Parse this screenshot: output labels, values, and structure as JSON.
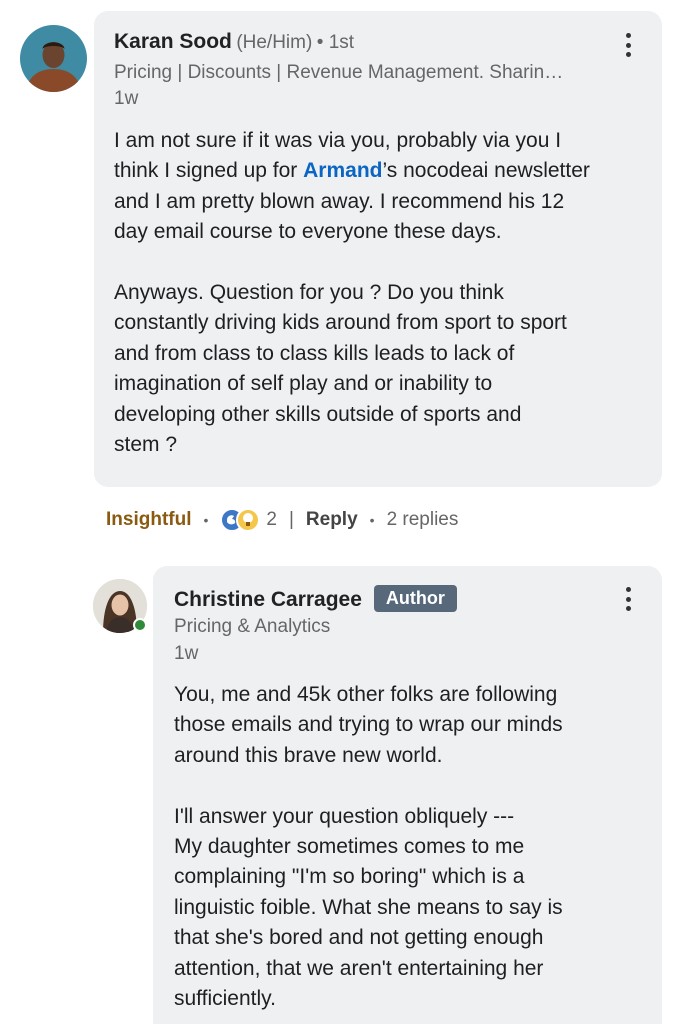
{
  "comment": {
    "author": "Karan Sood",
    "pronouns": "(He/Him)",
    "degree": "• 1st",
    "headline": "Pricing | Discounts | Revenue Management. Sharin…",
    "time": "1w",
    "body_pre": "I am not sure if it was via you, probably via you I\nthink I signed up for ",
    "mention": "Armand",
    "body_post": "’s nocodeai newsletter\nand I am pretty blown away. I recommend his 12\nday email course to everyone these days.\n\nAnyways. Question for you ? Do you think\nconstantly driving kids around from sport to sport\nand from class to class kills leads to lack of\nimagination of self play and or inability to\ndeveloping other skills outside of sports and\nstem ?"
  },
  "actions": {
    "reaction_label": "Insightful",
    "dot1": "•",
    "reaction_count": "2",
    "divider": "|",
    "reply_label": "Reply",
    "dot2": "•",
    "replies_label": "2 replies"
  },
  "reply": {
    "author": "Christine Carragee",
    "badge": "Author",
    "headline": "Pricing & Analytics",
    "time": "1w",
    "body": "You, me and 45k other folks are following\nthose emails and trying to wrap our minds\naround this brave new world.\n\nI'll answer your question obliquely ---\nMy daughter sometimes comes to me\ncomplaining \"I'm so boring\" which is a\nlinguistic foible.  What she means to say is\nthat she's bored and not getting enough\nattention, that we aren't entertaining her\nsufficiently."
  },
  "colors": {
    "bubble": "#eef0f2",
    "mention": "#0a66c2",
    "insightful": "#8a5a10",
    "author_badge": "#56687a",
    "presence": "#2e8b3a"
  },
  "icons": [
    "more-vertical-icon",
    "support-reaction-icon",
    "insightful-reaction-icon",
    "online-presence-icon"
  ]
}
